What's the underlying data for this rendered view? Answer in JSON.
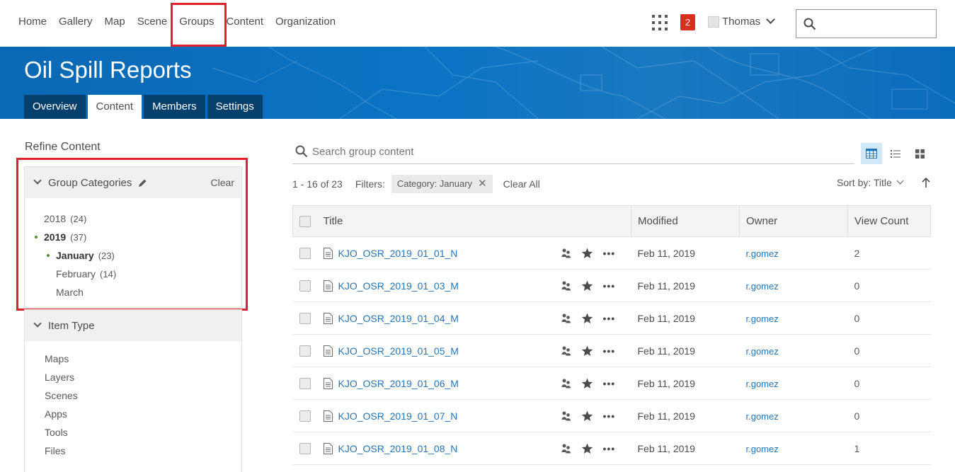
{
  "nav": {
    "links": [
      "Home",
      "Gallery",
      "Map",
      "Scene",
      "Groups",
      "Content",
      "Organization"
    ],
    "notifications": "2",
    "user": "Thomas",
    "search_placeholder": ""
  },
  "banner": {
    "title": "Oil Spill Reports",
    "tabs": [
      "Overview",
      "Content",
      "Members",
      "Settings"
    ],
    "active_tab": "Content"
  },
  "sidebar": {
    "heading": "Refine Content",
    "group_categories": {
      "label": "Group Categories",
      "clear": "Clear",
      "items": [
        {
          "label": "2018",
          "count": "(24)"
        },
        {
          "label": "2019",
          "count": "(37)"
        },
        {
          "label": "January",
          "count": "(23)"
        },
        {
          "label": "February",
          "count": "(14)"
        },
        {
          "label": "March",
          "count": ""
        }
      ]
    },
    "item_type": {
      "label": "Item Type",
      "items": [
        "Maps",
        "Layers",
        "Scenes",
        "Apps",
        "Tools",
        "Files"
      ]
    }
  },
  "main": {
    "search_placeholder": "Search group content",
    "results": "1 - 16 of 23",
    "filters_label": "Filters:",
    "filter_chip": "Category: January",
    "clear_all": "Clear All",
    "sort_label": "Sort by: Title",
    "columns": {
      "title": "Title",
      "modified": "Modified",
      "owner": "Owner",
      "views": "View Count"
    },
    "rows": [
      {
        "title": "KJO_OSR_2019_01_01_N",
        "modified": "Feb 11, 2019",
        "owner": "r.gomez",
        "views": "2"
      },
      {
        "title": "KJO_OSR_2019_01_03_M",
        "modified": "Feb 11, 2019",
        "owner": "r.gomez",
        "views": "0"
      },
      {
        "title": "KJO_OSR_2019_01_04_M",
        "modified": "Feb 11, 2019",
        "owner": "r.gomez",
        "views": "0"
      },
      {
        "title": "KJO_OSR_2019_01_05_M",
        "modified": "Feb 11, 2019",
        "owner": "r.gomez",
        "views": "0"
      },
      {
        "title": "KJO_OSR_2019_01_06_M",
        "modified": "Feb 11, 2019",
        "owner": "r.gomez",
        "views": "0"
      },
      {
        "title": "KJO_OSR_2019_01_07_N",
        "modified": "Feb 11, 2019",
        "owner": "r.gomez",
        "views": "0"
      },
      {
        "title": "KJO_OSR_2019_01_08_N",
        "modified": "Feb 11, 2019",
        "owner": "r.gomez",
        "views": "1"
      }
    ]
  },
  "colors": {
    "banner": "#0b74c5",
    "tab_dark": "#053f6b",
    "link": "#2774b5",
    "highlight": "#e0202a",
    "badge": "#d83020"
  }
}
